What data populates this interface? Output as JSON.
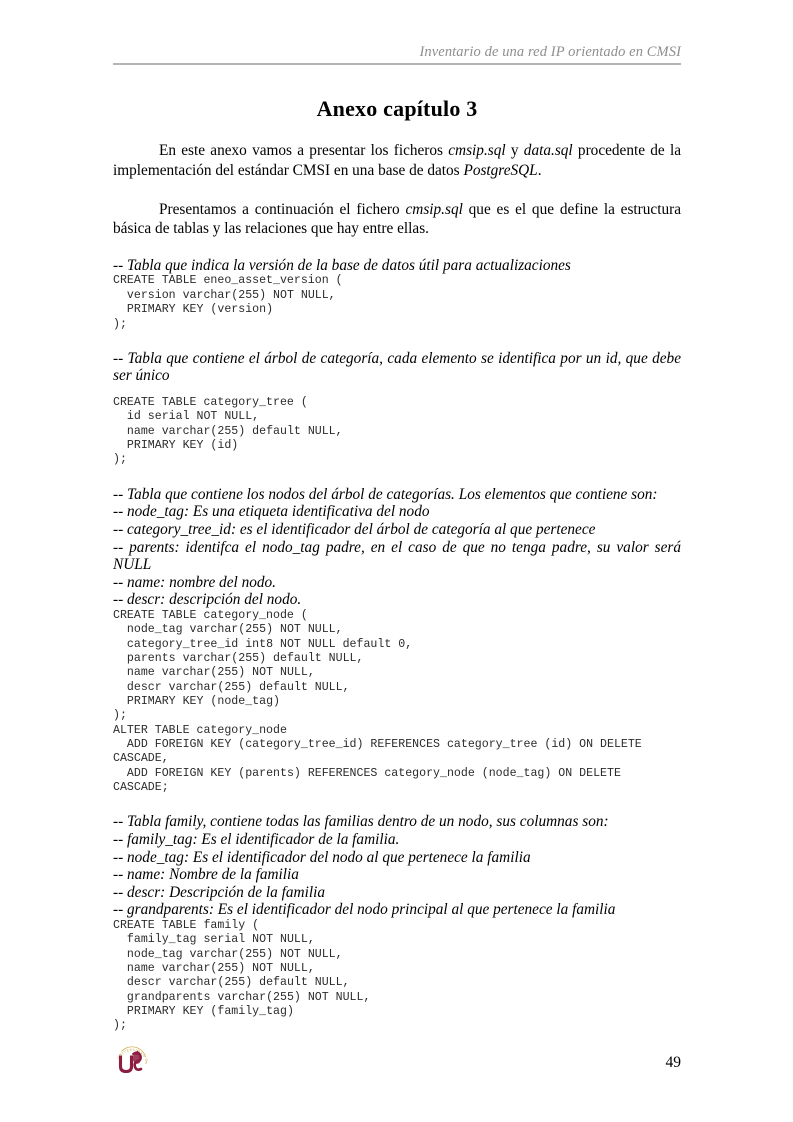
{
  "header": {
    "running_title": "Inventario de una red IP orientado en CMSI"
  },
  "title": "Anexo capítulo 3",
  "paragraphs": {
    "p1_part1": "En este anexo vamos a presentar los ficheros ",
    "p1_em1": "cmsip.sql",
    "p1_part2": " y ",
    "p1_em2": "data.sql",
    "p1_part3": " procedente de la implementación del estándar CMSI en una base de datos ",
    "p1_em3": "PostgreSQL",
    "p1_part4": ".",
    "p2_part1": "Presentamos a continuación el fichero ",
    "p2_em1": "cmsip.sql",
    "p2_part2": " que es el que define la estructura básica de  tablas y las relaciones que hay entre ellas."
  },
  "sections": [
    {
      "comment": "-- Tabla que indica la versión de la base de datos útil para actualizaciones",
      "code": "CREATE TABLE eneo_asset_version (\n  version varchar(255) NOT NULL,\n  PRIMARY KEY (version)\n);"
    },
    {
      "comment": "-- Tabla que contiene el árbol de categoría, cada elemento se identifica por un id, que debe ser único",
      "code": "CREATE TABLE category_tree (\n  id serial NOT NULL,\n  name varchar(255) default NULL,\n  PRIMARY KEY (id)\n);"
    },
    {
      "comment": "-- Tabla que contiene los nodos del árbol de categorías. Los elementos que contiene son:\n-- node_tag: Es una etiqueta identificativa del nodo\n-- category_tree_id: es el identificador del árbol de categoría al que pertenece",
      "comment_justified": "-- parents: identifca el nodo_tag padre, en el caso de que no tenga padre, su valor será NULL",
      "comment_tail": "-- name: nombre del nodo.\n-- descr: descripción del nodo.",
      "code": "CREATE TABLE category_node (\n  node_tag varchar(255) NOT NULL,\n  category_tree_id int8 NOT NULL default 0,\n  parents varchar(255) default NULL,\n  name varchar(255) NOT NULL,\n  descr varchar(255) default NULL,\n  PRIMARY KEY (node_tag)\n);",
      "code2": "ALTER TABLE category_node\n  ADD FOREIGN KEY (category_tree_id) REFERENCES category_tree (id) ON DELETE CASCADE,\n  ADD FOREIGN KEY (parents) REFERENCES category_node (node_tag) ON DELETE CASCADE;"
    },
    {
      "comment": "-- Tabla family, contiene todas las familias dentro de un nodo, sus columnas son:\n-- family_tag: Es el identificador de la familia.\n-- node_tag: Es el identificador del nodo al que pertenece la familia\n-- name: Nombre de la familia\n-- descr: Descripción de la familia\n-- grandparents: Es el identificador del nodo principal al que pertenece la familia",
      "code": "CREATE TABLE family (\n  family_tag serial NOT NULL,\n  node_tag varchar(255) NOT NULL,\n  name varchar(255) NOT NULL,\n  descr varchar(255) default NULL,\n  grandparents varchar(255) NOT NULL,\n  PRIMARY KEY (family_tag)\n);"
    }
  ],
  "footer": {
    "page_number": "49",
    "logo_name": "universidad-de-sevilla-logo",
    "logo_ring_text": "UNIVERSIDAD DE SEVILLA",
    "logo_letters": "US",
    "logo_color_primary": "#8c1d40",
    "logo_color_ring": "#c8a33c"
  }
}
